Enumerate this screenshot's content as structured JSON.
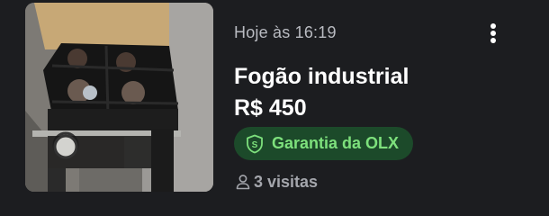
{
  "listing": {
    "timestamp": "Hoje às 16:19",
    "title": "Fogão industrial",
    "price": "R$ 450",
    "guarantee_label": "Garantia da OLX",
    "visits": "3 visitas"
  },
  "icons": {
    "menu": "kebab-menu-icon",
    "guarantee": "shield-icon",
    "visits": "user-icon"
  },
  "colors": {
    "background": "#1c1d20",
    "badge_background": "#1c4a2a",
    "badge_text": "#7de07c",
    "muted_text": "#b9bbc1"
  }
}
